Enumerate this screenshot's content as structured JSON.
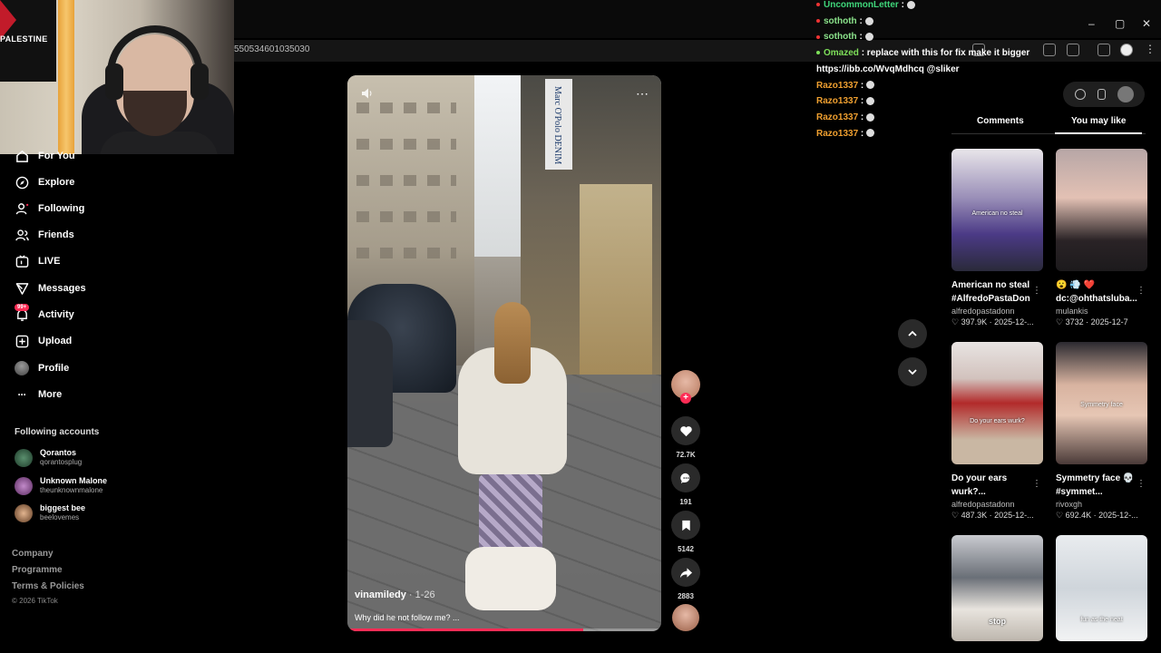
{
  "browser": {
    "url": "550534601035030",
    "window_controls": [
      "–",
      "▢",
      "✕"
    ]
  },
  "webcam": {
    "flag_text": "PALESTINE"
  },
  "sidebar": {
    "items": [
      {
        "label": "For You",
        "icon": "home-icon"
      },
      {
        "label": "Explore",
        "icon": "compass-icon"
      },
      {
        "label": "Following",
        "icon": "user-follow-icon"
      },
      {
        "label": "Friends",
        "icon": "friends-icon"
      },
      {
        "label": "LIVE",
        "icon": "live-icon"
      },
      {
        "label": "Messages",
        "icon": "send-icon"
      },
      {
        "label": "Activity",
        "icon": "bell-icon",
        "badge": "99+"
      },
      {
        "label": "Upload",
        "icon": "plus-square-icon"
      },
      {
        "label": "Profile",
        "icon": "avatar-icon"
      },
      {
        "label": "More",
        "icon": "dots-icon"
      }
    ],
    "following_title": "Following accounts",
    "accounts": [
      {
        "name": "Qorantos",
        "handle": "qorantosplug"
      },
      {
        "name": "Unknown Malone",
        "handle": "theunknownmalone"
      },
      {
        "name": "biggest bee",
        "handle": "beelovemes"
      }
    ],
    "footer": [
      "Company",
      "Programme",
      "Terms & Policies"
    ],
    "copyright": "© 2026 TikTok"
  },
  "video": {
    "author": "vinamiledy",
    "date": "· 1-26",
    "caption": "Why did he not follow me? ...",
    "progress": 0.75,
    "sign_text": "Marc O'Polo DENIM"
  },
  "actions": {
    "likes": "72.7K",
    "comments": "191",
    "saves": "5142",
    "shares": "2883"
  },
  "chat": [
    {
      "user": "UncommonLetter",
      "color": "#3fd67a",
      "text": ":"
    },
    {
      "user": "sothoth",
      "color": "#8be38b",
      "text": ":"
    },
    {
      "user": "sothoth",
      "color": "#8be38b",
      "text": ":"
    },
    {
      "user": "Omazed",
      "color": "#7ee05a",
      "text": ": replace  with this for fix make it bigger"
    },
    {
      "user": "",
      "color": "#ffffff",
      "text": "https://ibb.co/WvqMdhcq @sliker"
    },
    {
      "user": "Razo1337",
      "color": "#f0a030",
      "text": ":"
    },
    {
      "user": "Razo1337",
      "color": "#f0a030",
      "text": ":"
    },
    {
      "user": "Razo1337",
      "color": "#f0a030",
      "text": ":"
    },
    {
      "user": "Razo1337",
      "color": "#f0a030",
      "text": ":"
    }
  ],
  "panel": {
    "tabs": [
      "Comments",
      "You may like"
    ],
    "cards": [
      {
        "title": "American no steal #AlfredoPastaDon",
        "author": "alfredopastadonn",
        "likes": "397.9K",
        "date": "2025-12-...",
        "thumb_caption": "American no steal"
      },
      {
        "title": "😮 💨 ❤️ dc:@ohthatsluba...",
        "author": "mulankis",
        "likes": "3732",
        "date": "2025-12-7",
        "thumb_caption": ""
      },
      {
        "title": "Do your ears wurk?...",
        "author": "alfredopastadonn",
        "likes": "487.3K",
        "date": "2025-12-...",
        "thumb_caption": "Do your ears wurk?"
      },
      {
        "title": "Symmetry face 💀 #symmet...",
        "author": "rivoxgh",
        "likes": "692.4K",
        "date": "2025-12-...",
        "thumb_caption": "Symmetry face"
      },
      {
        "title": "",
        "author": "",
        "likes": "",
        "date": "",
        "thumb_caption": "stop"
      },
      {
        "title": "",
        "author": "",
        "likes": "",
        "date": "",
        "thumb_caption": "fun as the neat"
      }
    ]
  },
  "colors": {
    "accent": "#fe2c55",
    "background": "#000000"
  }
}
